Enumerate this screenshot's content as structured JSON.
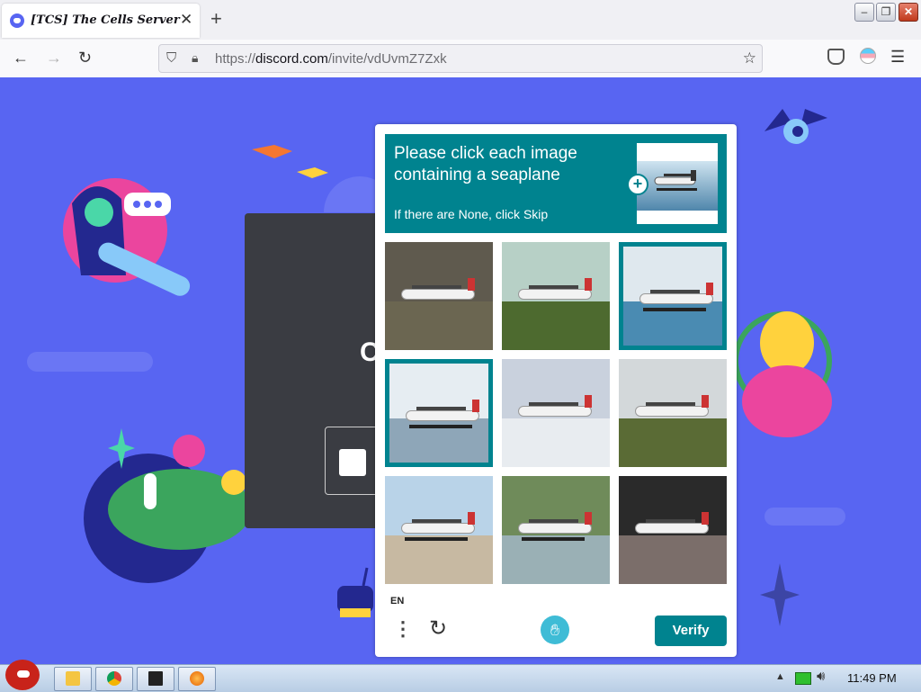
{
  "browser": {
    "tab_title": "[TCS] The Cells Server",
    "tab_close": "✕",
    "new_tab": "+",
    "url_prefix": "https://",
    "url_domain": "discord.com",
    "url_path": "/invite/vdUvmZ7Zxk"
  },
  "captcha": {
    "prompt": "Please click each image containing a seaplane",
    "skip_hint": "If there are None, click Skip",
    "language": "EN",
    "verify_label": "Verify",
    "accent_color": "#00838f",
    "tiles": [
      {
        "subject": "airplane",
        "selected": false
      },
      {
        "subject": "airplane",
        "selected": false
      },
      {
        "subject": "seaplane",
        "selected": true
      },
      {
        "subject": "seaplane",
        "selected": true
      },
      {
        "subject": "airplane",
        "selected": false
      },
      {
        "subject": "airplane",
        "selected": false
      },
      {
        "subject": "seaplane",
        "selected": false
      },
      {
        "subject": "seaplane",
        "selected": false
      },
      {
        "subject": "airplane",
        "selected": false
      }
    ]
  },
  "taskbar": {
    "clock": "11:49 PM",
    "apps": [
      "file-manager",
      "chrome",
      "7zip",
      "firefox"
    ]
  },
  "colors": {
    "page_background": "#5865f2"
  }
}
